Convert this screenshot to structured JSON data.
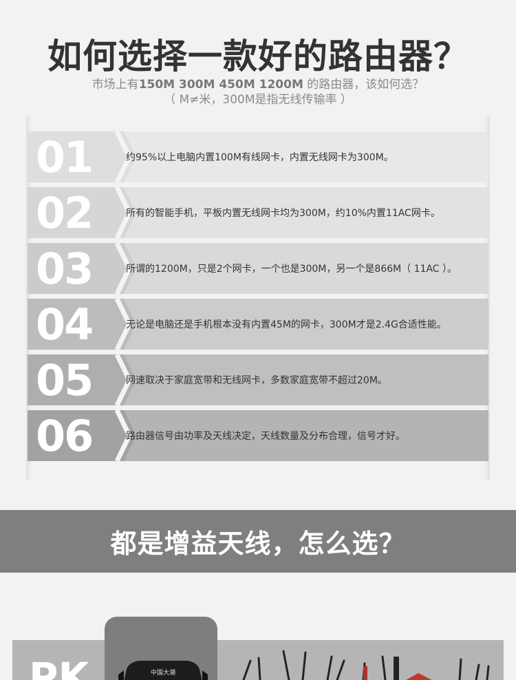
{
  "header": {
    "title": "如何选择一款好的路由器？",
    "subtitle_prefix": "市场上有",
    "subtitle_bold": "150M 300M 450M 1200M",
    "subtitle_suffix": " 的路由器，该如何选？",
    "subtitle_line2": "（ M≠米，300M是指无线传输率 ）"
  },
  "items": [
    {
      "num": "01",
      "text": "约95%以上电脑内置100M有线网卡，内置无线网卡为300M。",
      "bg": "#e8e8e8",
      "numbg": "#dedede"
    },
    {
      "num": "02",
      "text": "所有的智能手机，平板内置无线网卡均为300M，约10%内置11AC网卡。",
      "bg": "#e2e2e2",
      "numbg": "#d6d6d6"
    },
    {
      "num": "03",
      "text": "所谓的1200M，只是2个网卡，一个也是300M，另一个是866M（ 11AC ）。",
      "bg": "#d9d9d9",
      "numbg": "#cbcbcb"
    },
    {
      "num": "04",
      "text": "无论是电脑还是手机根本没有内置45M的网卡，300M才是2.4G合适性能。",
      "bg": "#cccccc",
      "numbg": "#bcbcbc"
    },
    {
      "num": "05",
      "text": "网速取决于家庭宽带和无线网卡，多数家庭宽带不超过20M。",
      "bg": "#bfbfbf",
      "numbg": "#aeaeae"
    },
    {
      "num": "06",
      "text": "路由器信号由功率及天线决定，天线数量及分布合理，信号才好。",
      "bg": "#b4b4b4",
      "numbg": "#a2a2a2"
    }
  ],
  "band": {
    "title": "都是增益天线，怎么选？"
  },
  "bottom": {
    "pk_label": "PK",
    "router_brand": "中国大潮"
  }
}
